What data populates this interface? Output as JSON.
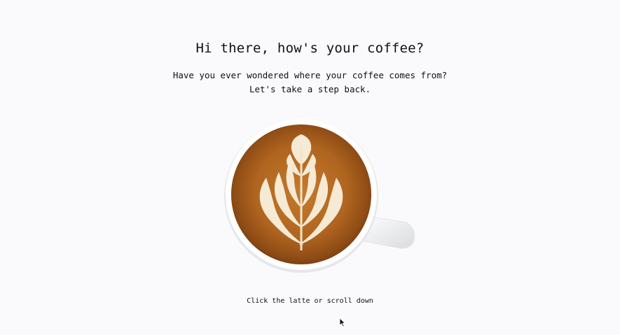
{
  "hero": {
    "title": "Hi there, how's your coffee?",
    "intro_line_1": "Have you ever wondered where your coffee comes from?",
    "intro_line_2": "Let's take a step back.",
    "hint": "Click the latte or scroll down"
  },
  "icons": {
    "latte": "latte-art-cup-icon",
    "cursor": "mouse-pointer-icon"
  },
  "colors": {
    "background": "#fafafc",
    "text": "#111111",
    "coffee": "#a8621e",
    "foam": "#f6ead4",
    "cup": "#ffffff"
  }
}
